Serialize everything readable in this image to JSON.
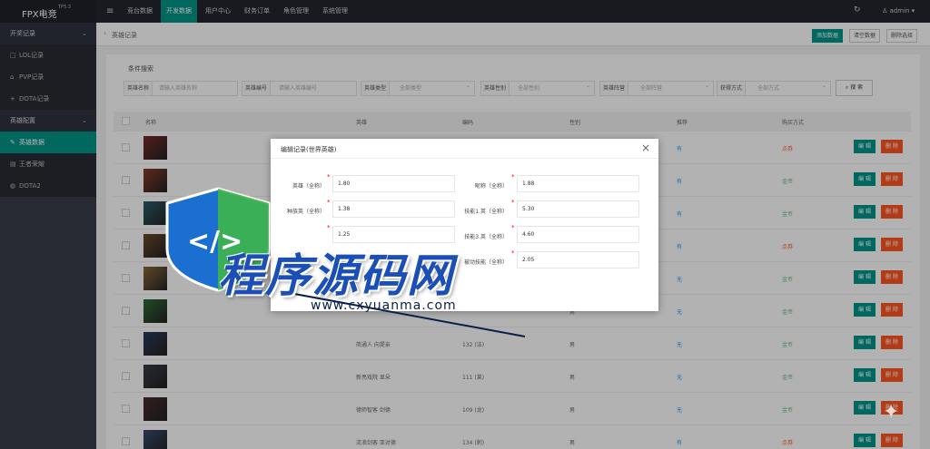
{
  "topbar": {
    "brand": "FPX电竞",
    "version": "TP5.3",
    "nav": [
      "竞台数据",
      "开发数据",
      "用户中心",
      "财务订单",
      "角色管理",
      "系统管理"
    ],
    "active_nav": 1,
    "user": "admin"
  },
  "sidebar": {
    "groups": [
      {
        "label": "开奖记录",
        "items": [
          {
            "label": "LOL记录",
            "icon": "□"
          },
          {
            "label": "PVP记录",
            "icon": "⌂"
          },
          {
            "label": "DOTA记录",
            "icon": "+"
          }
        ]
      },
      {
        "label": "英雄配置",
        "items": [
          {
            "label": "英雄数据",
            "icon": "✎"
          },
          {
            "label": "王者荣耀",
            "icon": "▤"
          },
          {
            "label": "DOTA2",
            "icon": "◍"
          }
        ]
      }
    ]
  },
  "breadcrumb": {
    "current": "英雄记录"
  },
  "crumb_buttons": [
    "添加数据",
    "清空数据",
    "删除选择"
  ],
  "filters": {
    "title": "条件搜索",
    "fields": [
      {
        "label": "英雄名称",
        "placeholder": "请输入英雄名称"
      },
      {
        "label": "英雄编号",
        "placeholder": "请输入英雄编号"
      },
      {
        "label": "英雄类型",
        "placeholder": "全部类型"
      },
      {
        "label": "英雄性别",
        "placeholder": "全部性别"
      },
      {
        "label": "英雄阵营",
        "placeholder": "全部阵营"
      },
      {
        "label": "获得方式",
        "placeholder": "全部方式"
      }
    ],
    "search_label": "搜 索"
  },
  "table": {
    "headers": [
      "名称",
      "英雄",
      "编码",
      "性别",
      "推荐",
      "购买方式"
    ],
    "rows": [
      {
        "name": "",
        "code": "",
        "gender": "",
        "rec": "有",
        "buy": "点券"
      },
      {
        "name": "",
        "code": "",
        "gender": "",
        "rec": "有",
        "buy": "金币"
      },
      {
        "name": "",
        "code": "",
        "gender": "",
        "rec": "有",
        "buy": "金币"
      },
      {
        "name": "",
        "code": "",
        "gender": "",
        "rec": "有",
        "buy": "点券"
      },
      {
        "name": "",
        "code": "",
        "gender": "",
        "rec": "无",
        "buy": "金币"
      },
      {
        "name": "",
        "code": "",
        "gender": "男",
        "rec": "无",
        "buy": "金币"
      },
      {
        "name": "简通人 向提亲",
        "code": "132 (法)",
        "gender": "男",
        "rec": "无",
        "buy": "金币"
      },
      {
        "name": "新亮戏院 显朵",
        "code": "111 (莱)",
        "gender": "男",
        "rec": "无",
        "buy": "金币"
      },
      {
        "name": "德师智客 剑德",
        "code": "109 (龙)",
        "gender": "男",
        "rec": "无",
        "buy": "金币"
      },
      {
        "name": "流浪剑客 亚对德",
        "code": "134 (刺)",
        "gender": "男",
        "rec": "有",
        "buy": "点券"
      }
    ],
    "edit_label": "编 辑",
    "delete_label": "删 除"
  },
  "dialog": {
    "title": "编辑记录(世界英雄)",
    "fields": [
      {
        "label": "英雄（全称）",
        "value": "1.80"
      },
      {
        "label": "昵称（全称）",
        "value": "1.88"
      },
      {
        "label": "种族英（全称）",
        "value": "1.38"
      },
      {
        "label": "技能1.英（全称）",
        "value": "5.30"
      },
      {
        "label": "",
        "value": "1.25"
      },
      {
        "label": "技能3.英（全称）",
        "value": "4.60"
      },
      {
        "label": "被动技能（全称）",
        "value": "2.05"
      }
    ]
  },
  "watermark": {
    "text": "程序源码网",
    "url": "www.cxyuanma.com"
  },
  "colors": {
    "accent": "#009688",
    "danger": "#ff5722",
    "topbar": "#23262e",
    "sidebar": "#393d49",
    "link": "#1e9fff"
  }
}
